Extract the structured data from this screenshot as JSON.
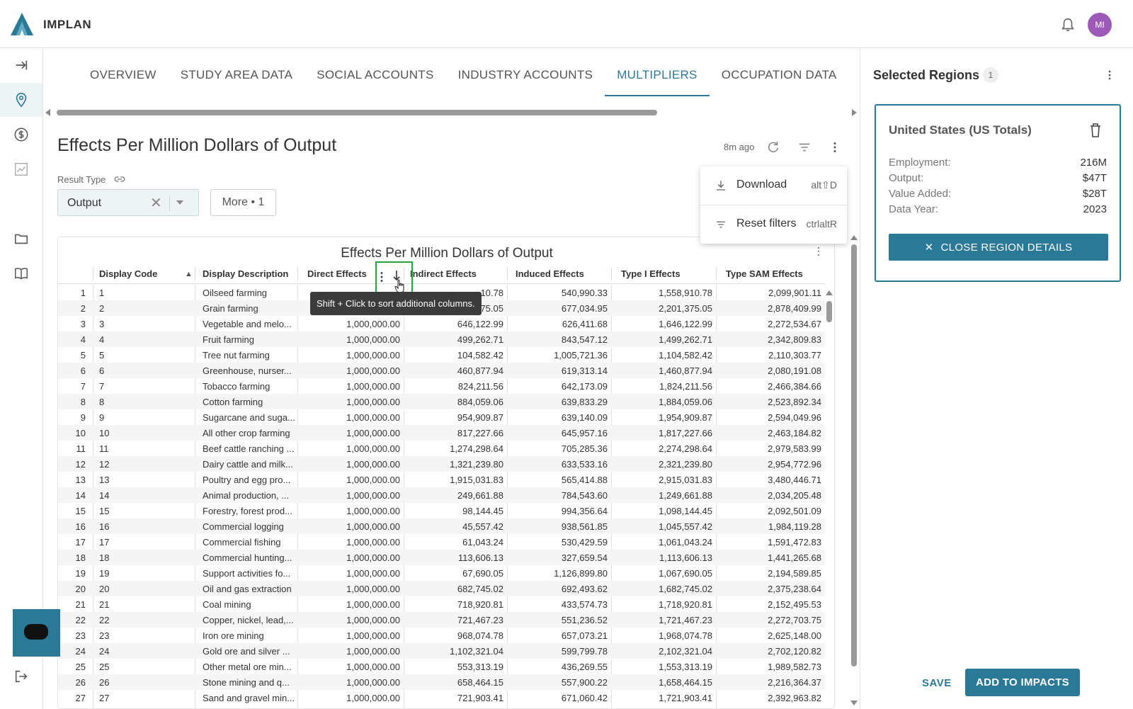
{
  "app": {
    "brand": "IMPLAN",
    "avatar_initials": "MI",
    "accent_color": "#2a7a97"
  },
  "rail": {
    "items": [
      {
        "name": "expand-icon"
      },
      {
        "name": "location-pin-icon",
        "active": true
      },
      {
        "name": "dollar-icon"
      },
      {
        "name": "chart-icon"
      },
      {
        "name": "folder-icon"
      },
      {
        "name": "book-icon"
      },
      {
        "name": "logout-icon"
      }
    ]
  },
  "tabs": [
    {
      "label": "OVERVIEW"
    },
    {
      "label": "STUDY AREA DATA"
    },
    {
      "label": "SOCIAL ACCOUNTS"
    },
    {
      "label": "INDUSTRY ACCOUNTS"
    },
    {
      "label": "MULTIPLIERS",
      "active": true
    },
    {
      "label": "OCCUPATION DATA"
    }
  ],
  "header": {
    "title": "Effects Per Million Dollars of Output",
    "updated": "8m ago"
  },
  "filters": {
    "result_type_label": "Result Type",
    "result_type_value": "Output",
    "more_label": "More • 1"
  },
  "menu": {
    "items": [
      {
        "label": "Download",
        "shortcut": "alt⇧D",
        "icon": "download-icon"
      },
      {
        "label": "Reset filters",
        "shortcut": "ctrlaltR",
        "icon": "filter-lines-icon"
      }
    ]
  },
  "grid": {
    "title": "Effects Per Million Dollars of Output",
    "tooltip": "Shift + Click to sort additional columns.",
    "columns": [
      "Display Code",
      "Display Description",
      "Direct Effects",
      "Indirect Effects",
      "Induced Effects",
      "Type I Effects",
      "Type SAM Effects"
    ],
    "rows": [
      [
        "1",
        "1",
        "Oilseed farming",
        "",
        "10.78",
        "540,990.33",
        "1,558,910.78",
        "2,099,901.11"
      ],
      [
        "2",
        "2",
        "Grain farming",
        "",
        "75.05",
        "677,034.95",
        "2,201,375.05",
        "2,878,409.99"
      ],
      [
        "3",
        "3",
        "Vegetable and melo...",
        "1,000,000.00",
        "646,122.99",
        "626,411.68",
        "1,646,122.99",
        "2,272,534.67"
      ],
      [
        "4",
        "4",
        "Fruit farming",
        "1,000,000.00",
        "499,262.71",
        "843,547.12",
        "1,499,262.71",
        "2,342,809.83"
      ],
      [
        "5",
        "5",
        "Tree nut farming",
        "1,000,000.00",
        "104,582.42",
        "1,005,721.36",
        "1,104,582.42",
        "2,110,303.77"
      ],
      [
        "6",
        "6",
        "Greenhouse, nurser...",
        "1,000,000.00",
        "460,877.94",
        "619,313.14",
        "1,460,877.94",
        "2,080,191.08"
      ],
      [
        "7",
        "7",
        "Tobacco farming",
        "1,000,000.00",
        "824,211.56",
        "642,173.09",
        "1,824,211.56",
        "2,466,384.66"
      ],
      [
        "8",
        "8",
        "Cotton farming",
        "1,000,000.00",
        "884,059.06",
        "639,833.29",
        "1,884,059.06",
        "2,523,892.34"
      ],
      [
        "9",
        "9",
        "Sugarcane and suga...",
        "1,000,000.00",
        "954,909.87",
        "639,140.09",
        "1,954,909.87",
        "2,594,049.96"
      ],
      [
        "10",
        "10",
        "All other crop farming",
        "1,000,000.00",
        "817,227.66",
        "645,957.16",
        "1,817,227.66",
        "2,463,184.82"
      ],
      [
        "11",
        "11",
        "Beef cattle ranching ...",
        "1,000,000.00",
        "1,274,298.64",
        "705,285.36",
        "2,274,298.64",
        "2,979,583.99"
      ],
      [
        "12",
        "12",
        "Dairy cattle and milk...",
        "1,000,000.00",
        "1,321,239.80",
        "633,533.16",
        "2,321,239.80",
        "2,954,772.96"
      ],
      [
        "13",
        "13",
        "Poultry and egg pro...",
        "1,000,000.00",
        "1,915,031.83",
        "565,414.88",
        "2,915,031.83",
        "3,480,446.71"
      ],
      [
        "14",
        "14",
        "Animal production, ...",
        "1,000,000.00",
        "249,661.88",
        "784,543.60",
        "1,249,661.88",
        "2,034,205.48"
      ],
      [
        "15",
        "15",
        "Forestry, forest prod...",
        "1,000,000.00",
        "98,144.45",
        "994,356.64",
        "1,098,144.45",
        "2,092,501.09"
      ],
      [
        "16",
        "16",
        "Commercial logging",
        "1,000,000.00",
        "45,557.42",
        "938,561.85",
        "1,045,557.42",
        "1,984,119.28"
      ],
      [
        "17",
        "17",
        "Commercial fishing",
        "1,000,000.00",
        "61,043.24",
        "530,429.59",
        "1,061,043.24",
        "1,591,472.83"
      ],
      [
        "18",
        "18",
        "Commercial hunting...",
        "1,000,000.00",
        "113,606.13",
        "327,659.54",
        "1,113,606.13",
        "1,441,265.68"
      ],
      [
        "19",
        "19",
        "Support activities fo...",
        "1,000,000.00",
        "67,690.05",
        "1,126,899.80",
        "1,067,690.05",
        "2,194,589.85"
      ],
      [
        "20",
        "20",
        "Oil and gas extraction",
        "1,000,000.00",
        "682,745.02",
        "692,493.62",
        "1,682,745.02",
        "2,375,238.64"
      ],
      [
        "21",
        "21",
        "Coal mining",
        "1,000,000.00",
        "718,920.81",
        "433,574.73",
        "1,718,920.81",
        "2,152,495.53"
      ],
      [
        "22",
        "22",
        "Copper, nickel, lead,...",
        "1,000,000.00",
        "721,467.23",
        "551,236.52",
        "1,721,467.23",
        "2,272,703.75"
      ],
      [
        "23",
        "23",
        "Iron ore mining",
        "1,000,000.00",
        "968,074.78",
        "657,073.21",
        "1,968,074.78",
        "2,625,148.00"
      ],
      [
        "24",
        "24",
        "Gold ore and silver ...",
        "1,000,000.00",
        "1,102,321.04",
        "599,799.78",
        "2,102,321.04",
        "2,702,120.82"
      ],
      [
        "25",
        "25",
        "Other metal ore min...",
        "1,000,000.00",
        "553,313.19",
        "436,269.55",
        "1,553,313.19",
        "1,989,582.73"
      ],
      [
        "26",
        "26",
        "Stone mining and q...",
        "1,000,000.00",
        "658,464.15",
        "557,900.22",
        "1,658,464.15",
        "2,216,364.37"
      ],
      [
        "27",
        "27",
        "Sand and gravel min...",
        "1,000,000.00",
        "721,903.41",
        "671,060.42",
        "1,721,903.41",
        "2,392,963.82"
      ]
    ]
  },
  "regions": {
    "title": "Selected Regions",
    "count": "1",
    "card": {
      "name": "United States (US Totals)",
      "stats": [
        {
          "label": "Employment:",
          "value": "216M"
        },
        {
          "label": "Output:",
          "value": "$47T"
        },
        {
          "label": "Value Added:",
          "value": "$28T"
        },
        {
          "label": "Data Year:",
          "value": "2023"
        }
      ],
      "close_label": "CLOSE REGION DETAILS"
    },
    "save_label": "SAVE",
    "add_label": "ADD TO IMPACTS"
  }
}
